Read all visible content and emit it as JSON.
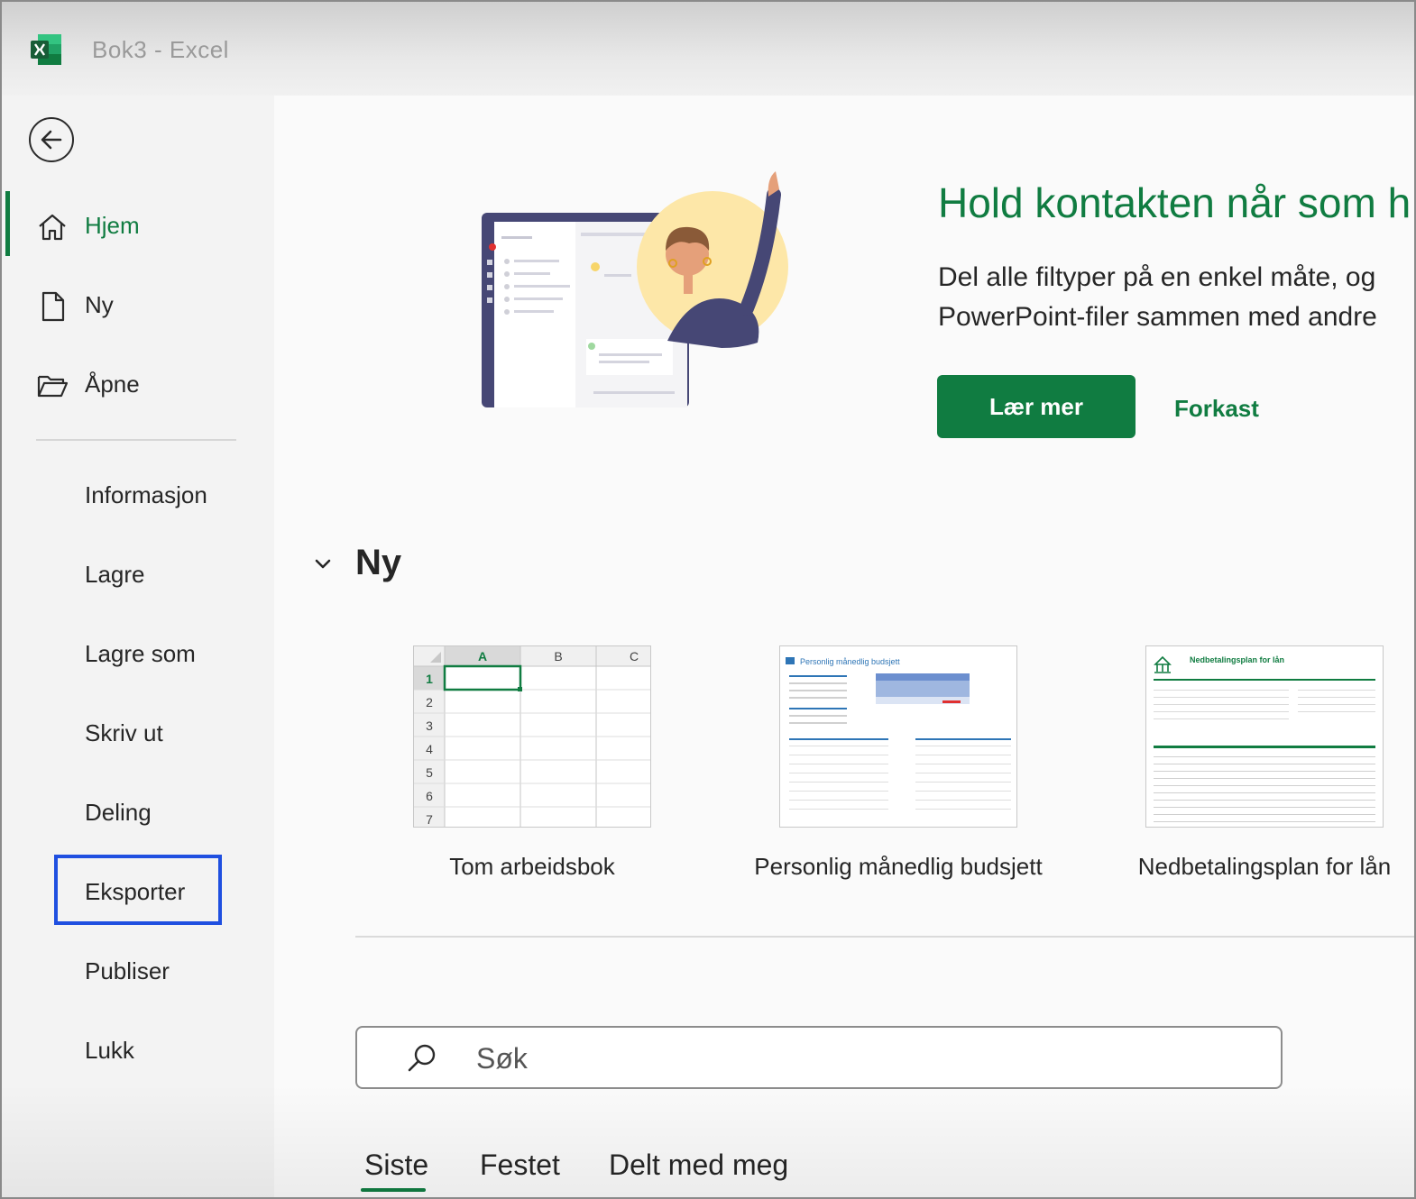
{
  "window": {
    "title": "Bok3  -  Excel"
  },
  "sidebar": {
    "primary": [
      {
        "label": "Hjem"
      },
      {
        "label": "Ny"
      },
      {
        "label": "Åpne"
      }
    ],
    "secondary": [
      {
        "label": "Informasjon"
      },
      {
        "label": "Lagre"
      },
      {
        "label": "Lagre som"
      },
      {
        "label": "Skriv ut"
      },
      {
        "label": "Deling"
      },
      {
        "label": "Eksporter"
      },
      {
        "label": "Publiser"
      },
      {
        "label": "Lukk"
      }
    ]
  },
  "banner": {
    "title": "Hold kontakten når som h",
    "line1": "Del alle filtyper på en enkel måte, og",
    "line2": "PowerPoint-filer sammen med andre",
    "learn_more": "Lær mer",
    "dismiss": "Forkast"
  },
  "new_section": {
    "title": "Ny",
    "templates": [
      {
        "label": "Tom arbeidsbok"
      },
      {
        "label": "Personlig månedlig budsjett"
      },
      {
        "label": "Nedbetalingsplan for lån"
      }
    ],
    "blank_grid": {
      "columns": [
        "A",
        "B",
        "C"
      ],
      "rows": [
        "1",
        "2",
        "3",
        "4",
        "5",
        "6",
        "7"
      ]
    },
    "budget_thumb_title": "Personlig månedlig budsjett",
    "loan_thumb_title": "Nedbetalingsplan for lån"
  },
  "search": {
    "placeholder": "Søk"
  },
  "tabs": [
    {
      "label": "Siste"
    },
    {
      "label": "Festet"
    },
    {
      "label": "Delt med meg"
    }
  ],
  "colors": {
    "accent": "#107c41",
    "highlight": "#1f4fe0"
  }
}
